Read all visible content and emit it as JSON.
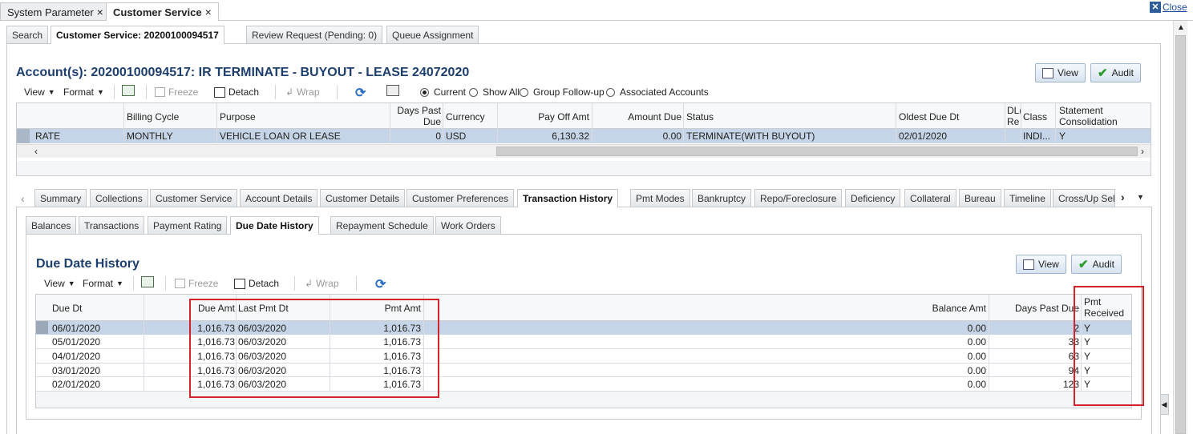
{
  "top_tabs": [
    {
      "label": "System Parameter"
    },
    {
      "label": "Customer Service"
    }
  ],
  "close_label": "Close",
  "cs_tabs": [
    {
      "label": "Search"
    },
    {
      "label": "Customer Service: 20200100094517"
    },
    {
      "label": "Review Request (Pending: 0)"
    },
    {
      "label": "Queue Assignment"
    }
  ],
  "account": {
    "title": "Account(s): 20200100094517: IR TERMINATE - BUYOUT - LEASE 24072020",
    "view_label": "View",
    "audit_label": "Audit"
  },
  "toolbar": {
    "view": "View",
    "format": "Format",
    "freeze": "Freeze",
    "detach": "Detach",
    "wrap": "Wrap"
  },
  "radios": [
    {
      "label": "Current",
      "selected": true
    },
    {
      "label": "Show All",
      "selected": false
    },
    {
      "label": "Group Follow-up",
      "selected": false
    },
    {
      "label": "Associated Accounts",
      "selected": false
    }
  ],
  "account_table": {
    "headers": {
      "billing_cycle": "Billing Cycle",
      "purpose": "Purpose",
      "days_past_due_1": "Days Past",
      "days_past_due_2": "Due",
      "currency": "Currency",
      "pay_off_amt": "Pay Off Amt",
      "amount_due": "Amount Due",
      "status": "Status",
      "oldest_due_dt": "Oldest Due Dt",
      "dl_1": "DL(",
      "dl_2": "Re",
      "class": "Class",
      "stmt_1": "Statement",
      "stmt_2": "Consolidation"
    },
    "row": {
      "rate": "RATE",
      "billing_cycle": "MONTHLY",
      "purpose": "VEHICLE LOAN OR LEASE",
      "days_past_due": "0",
      "currency": "USD",
      "pay_off_amt": "6,130.32",
      "amount_due": "0.00",
      "status": "TERMINATE(WITH BUYOUT)",
      "oldest_due_dt": "02/01/2020",
      "class": "INDI...",
      "stmt": "Y"
    }
  },
  "detail_tabs": [
    {
      "label": "Summary"
    },
    {
      "label": "Collections"
    },
    {
      "label": "Customer Service"
    },
    {
      "label": "Account Details"
    },
    {
      "label": "Customer Details"
    },
    {
      "label": "Customer Preferences"
    },
    {
      "label": "Transaction History"
    },
    {
      "label": "Pmt Modes"
    },
    {
      "label": "Bankruptcy"
    },
    {
      "label": "Repo/Foreclosure"
    },
    {
      "label": "Deficiency"
    },
    {
      "label": "Collateral"
    },
    {
      "label": "Bureau"
    },
    {
      "label": "Timeline"
    },
    {
      "label": "Cross/Up Sell"
    }
  ],
  "history_tabs": [
    {
      "label": "Balances"
    },
    {
      "label": "Transactions"
    },
    {
      "label": "Payment Rating"
    },
    {
      "label": "Due Date History"
    },
    {
      "label": "Repayment Schedule"
    },
    {
      "label": "Work Orders"
    }
  ],
  "due_date_history": {
    "title": "Due Date History",
    "view_label": "View",
    "audit_label": "Audit",
    "headers": {
      "due_dt": "Due Dt",
      "due_amt": "Due Amt",
      "last_pmt_dt": "Last Pmt Dt",
      "pmt_amt": "Pmt Amt",
      "balance_amt": "Balance Amt",
      "days_past_due": "Days Past Due",
      "pmt_received_1": "Pmt",
      "pmt_received_2": "Received"
    },
    "rows": [
      {
        "due_dt": "06/01/2020",
        "due_amt": "1,016.73",
        "last_pmt_dt": "06/03/2020",
        "pmt_amt": "1,016.73",
        "balance_amt": "0.00",
        "days_past_due": "2",
        "pmt_received": "Y"
      },
      {
        "due_dt": "05/01/2020",
        "due_amt": "1,016.73",
        "last_pmt_dt": "06/03/2020",
        "pmt_amt": "1,016.73",
        "balance_amt": "0.00",
        "days_past_due": "33",
        "pmt_received": "Y"
      },
      {
        "due_dt": "04/01/2020",
        "due_amt": "1,016.73",
        "last_pmt_dt": "06/03/2020",
        "pmt_amt": "1,016.73",
        "balance_amt": "0.00",
        "days_past_due": "63",
        "pmt_received": "Y"
      },
      {
        "due_dt": "03/01/2020",
        "due_amt": "1,016.73",
        "last_pmt_dt": "06/03/2020",
        "pmt_amt": "1,016.73",
        "balance_amt": "0.00",
        "days_past_due": "94",
        "pmt_received": "Y"
      },
      {
        "due_dt": "02/01/2020",
        "due_amt": "1,016.73",
        "last_pmt_dt": "06/03/2020",
        "pmt_amt": "1,016.73",
        "balance_amt": "0.00",
        "days_past_due": "123",
        "pmt_received": "Y"
      }
    ]
  },
  "colors": {
    "title_blue": "#1d3f6e",
    "highlight_red": "#d3222a",
    "selected_row": "#b9cbe0"
  }
}
